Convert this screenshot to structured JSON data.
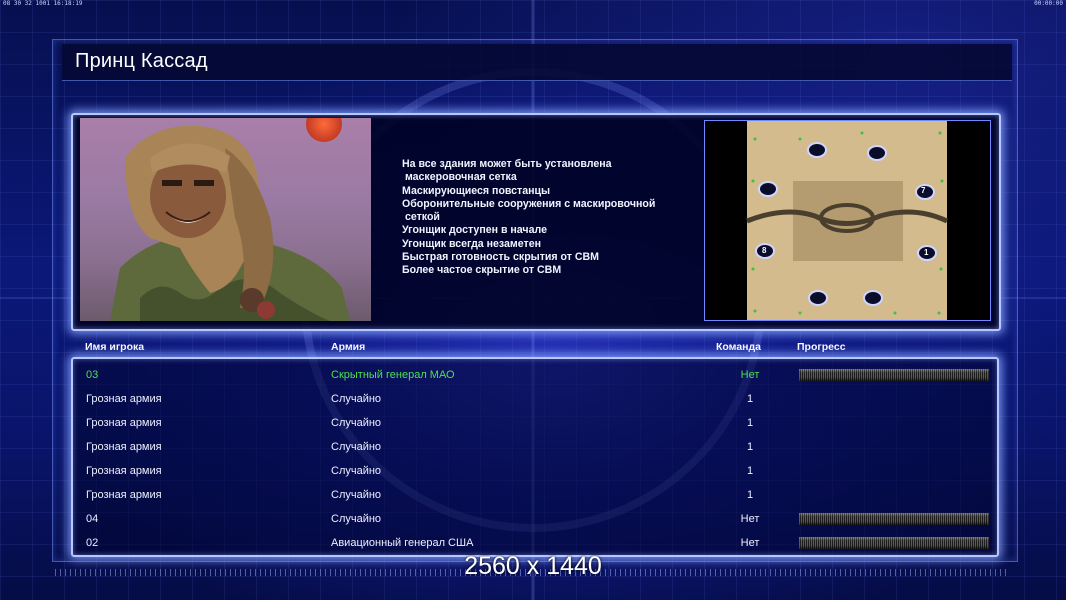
{
  "hud": {
    "top_left": "08 30 32 1001 16:18:19",
    "top_right": "00:00:00"
  },
  "title": "Принц Кассад",
  "features": [
    "На все здания может быть установлена",
    " маскеровочная сетка",
    "Маскирующиеся повстанцы",
    "Оборонительные сооружения с маскировочной",
    " сеткой",
    "Угонщик доступен в начале",
    "Угонщик всегда незаметен",
    "Быстрая готовность скрытия от СВМ",
    "Более частое скрытие от СВМ"
  ],
  "map": {
    "start_positions": [
      "7",
      "8",
      "1"
    ]
  },
  "table": {
    "headers": {
      "name": "Имя игрока",
      "army": "Армия",
      "team": "Команда",
      "progress": "Прогресс"
    },
    "rows": [
      {
        "name": "03",
        "army": "Скрытный генерал МАО",
        "team": "Нет",
        "progress": true,
        "highlight": true
      },
      {
        "name": "Грозная армия",
        "army": "Случайно",
        "team": "1",
        "progress": false,
        "highlight": false
      },
      {
        "name": "Грозная армия",
        "army": "Случайно",
        "team": "1",
        "progress": false,
        "highlight": false
      },
      {
        "name": "Грозная армия",
        "army": "Случайно",
        "team": "1",
        "progress": false,
        "highlight": false
      },
      {
        "name": "Грозная армия",
        "army": "Случайно",
        "team": "1",
        "progress": false,
        "highlight": false
      },
      {
        "name": "Грозная армия",
        "army": "Случайно",
        "team": "1",
        "progress": false,
        "highlight": false
      },
      {
        "name": "04",
        "army": "Случайно",
        "team": "Нет",
        "progress": true,
        "highlight": false
      },
      {
        "name": "02",
        "army": "Авиационный генерал США",
        "team": "Нет",
        "progress": true,
        "highlight": false
      }
    ]
  },
  "resolution_label": "2560 x 1440",
  "colors": {
    "highlight_player": "#4fe04f",
    "panel_glow": "#b7c8ff",
    "background": "#0b1878"
  }
}
